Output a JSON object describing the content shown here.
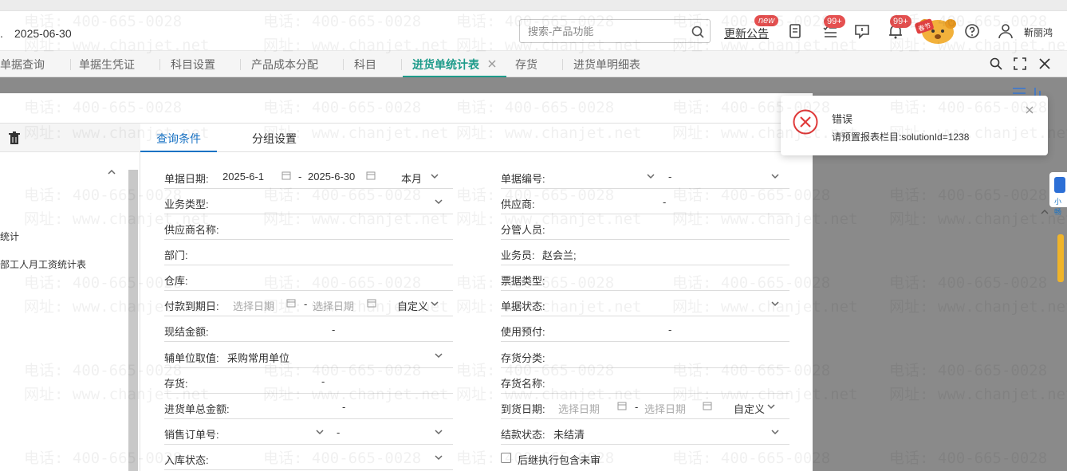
{
  "header": {
    "date": "2025-06-30",
    "search_placeholder": "搜索-产品功能",
    "notice_label": "更新公告",
    "badge_new": "new",
    "badge_tasks": "99+",
    "badge_bell": "99+",
    "mascot_text": "春节",
    "username": "靳丽鸿"
  },
  "tabs": [
    {
      "label": "单据查询"
    },
    {
      "label": "单据生凭证"
    },
    {
      "label": "科目设置"
    },
    {
      "label": "产品成本分配"
    },
    {
      "label": "科目"
    },
    {
      "label": "进货单统计表"
    },
    {
      "label": "存货"
    },
    {
      "label": "进货单明细表"
    }
  ],
  "left_panel": {
    "items": [
      "统计",
      "部工人月工资统计表"
    ]
  },
  "query_tabs": [
    {
      "label": "查询条件"
    },
    {
      "label": "分组设置"
    }
  ],
  "form": {
    "bill_date": {
      "label": "单据日期:",
      "from": "2025-6-1",
      "to": "2025-6-30",
      "range": "本月",
      "sep": "-"
    },
    "biz_type": {
      "label": "业务类型:"
    },
    "supplier_name": {
      "label": "供应商名称:"
    },
    "dept": {
      "label": "部门:"
    },
    "warehouse": {
      "label": "仓库:"
    },
    "pay_due": {
      "label": "付款到期日:",
      "from_placeholder": "选择日期",
      "to_placeholder": "选择日期",
      "range": "自定义",
      "sep": "-"
    },
    "cash_amount": {
      "label": "现结金额:",
      "sep": "-"
    },
    "aux_unit": {
      "label": "辅单位取值:",
      "value": "采购常用单位"
    },
    "inventory": {
      "label": "存货:",
      "sep": "-"
    },
    "total_amount": {
      "label": "进货单总金额:",
      "sep": "-"
    },
    "sales_order": {
      "label": "销售订单号:",
      "sep": "-"
    },
    "in_status": {
      "label": "入库状态:"
    },
    "bill_no": {
      "label": "单据编号:",
      "sep": "-"
    },
    "supplier": {
      "label": "供应商:",
      "sep": "-"
    },
    "manager": {
      "label": "分管人员:"
    },
    "salesman": {
      "label": "业务员:",
      "value": "赵会兰;"
    },
    "receipt_type": {
      "label": "票据类型:"
    },
    "bill_status": {
      "label": "单据状态:"
    },
    "prepay": {
      "label": "使用预付:",
      "sep": "-"
    },
    "inv_category": {
      "label": "存货分类:"
    },
    "inv_name": {
      "label": "存货名称:"
    },
    "arrival": {
      "label": "到货日期:",
      "from_placeholder": "选择日期",
      "to_placeholder": "选择日期",
      "range": "自定义",
      "sep": "-"
    },
    "settle_status": {
      "label": "结款状态:",
      "value": "未结清"
    },
    "follow_unaudited": {
      "label": "后继执行包含未审"
    }
  },
  "toast": {
    "title": "错误",
    "message": "请预置报表栏目:solutionId=1238"
  },
  "right_widget": {
    "label": "小畅"
  },
  "watermark": {
    "phone": "电话: 400-665-0028",
    "site": "网址: www.chanjet.net"
  },
  "colors": {
    "active_tab": "#1d9b8a",
    "link_blue": "#1a73c4",
    "error_red": "#e03a3a",
    "badge_red": "#e55050"
  }
}
